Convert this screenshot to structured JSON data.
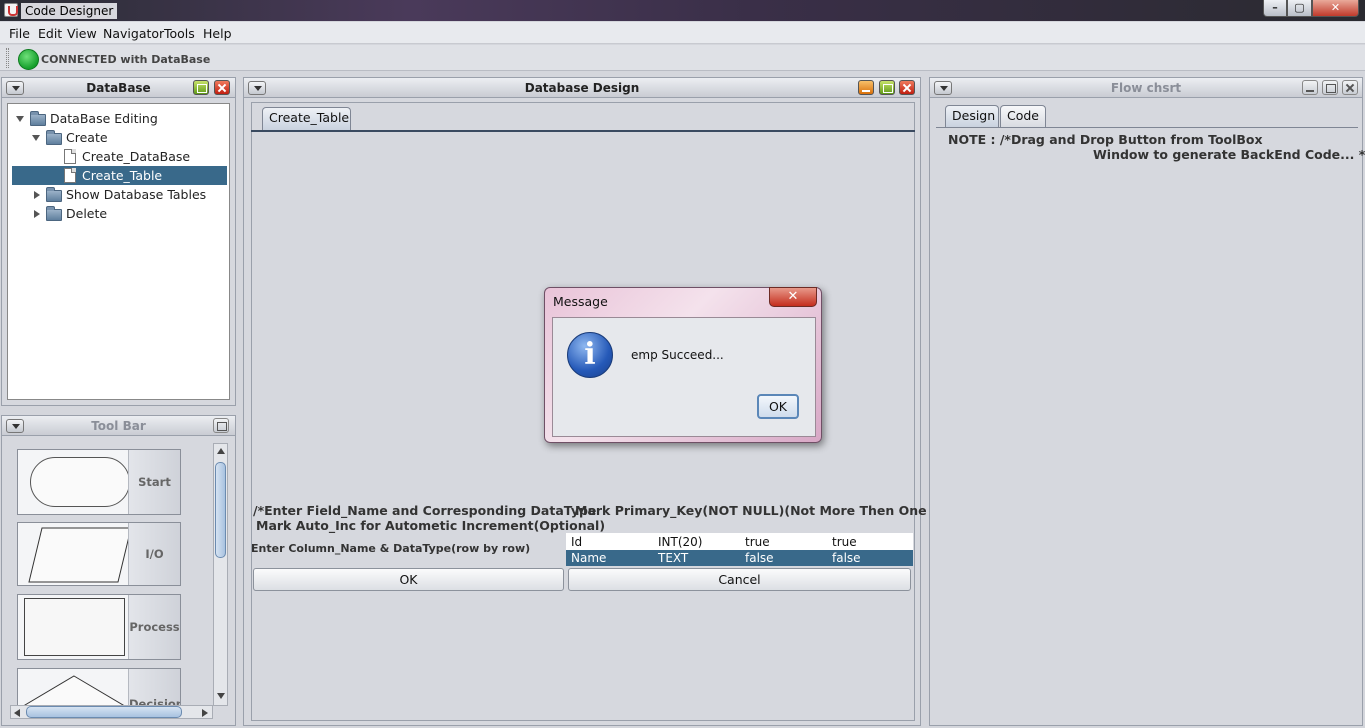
{
  "window": {
    "title": "Code Designer",
    "min_icon": "minimize-icon",
    "max_icon": "maximize-icon",
    "close_icon": "close-icon"
  },
  "menu": [
    "File",
    "Edit",
    "View",
    "Navigator",
    "Tools",
    "Help"
  ],
  "status": {
    "text": "CONNECTED with DataBase",
    "indicator_color": "#1aa32f"
  },
  "database_panel": {
    "title": "DataBase",
    "tree": [
      {
        "label": "DataBase Editing",
        "expanded": true
      },
      {
        "label": "Create",
        "expanded": true
      },
      {
        "label": "Create_DataBase"
      },
      {
        "label": "Create_Table",
        "selected": true
      },
      {
        "label": "Show Database Tables",
        "expanded": false
      },
      {
        "label": "Delete",
        "expanded": false
      }
    ]
  },
  "toolbar_panel": {
    "title": "Tool Bar",
    "tools": [
      "Start",
      "I/O",
      "Process",
      "Decision"
    ]
  },
  "design_panel": {
    "title": "Database Design",
    "tab": "Create_Table",
    "instruction_left_1": "/*Enter Field_Name and Corresponding DataType",
    "instruction_left_2": "Mark Auto_Inc for Autometic Increment(Optional)",
    "instruction_right": "Mark Primary_Key(NOT NULL)(Not More Then One Time)",
    "column_hint": "Enter Column_Name & DataType(row by row)",
    "rows": [
      [
        "Id",
        "INT(20)",
        "true",
        "true"
      ],
      [
        "Name",
        "TEXT",
        "false",
        "false"
      ]
    ],
    "ok_label": "OK",
    "cancel_label": "Cancel"
  },
  "flow_panel": {
    "title": "Flow chsrt",
    "tabs": [
      "Design",
      "Code"
    ],
    "note_1": "NOTE : /*Drag and Drop Button from ToolBox",
    "note_2": "Window to generate BackEnd Code... */"
  },
  "dialog": {
    "title": "Message",
    "message": "emp Succeed...",
    "ok_label": "OK",
    "icon": "info-icon"
  }
}
